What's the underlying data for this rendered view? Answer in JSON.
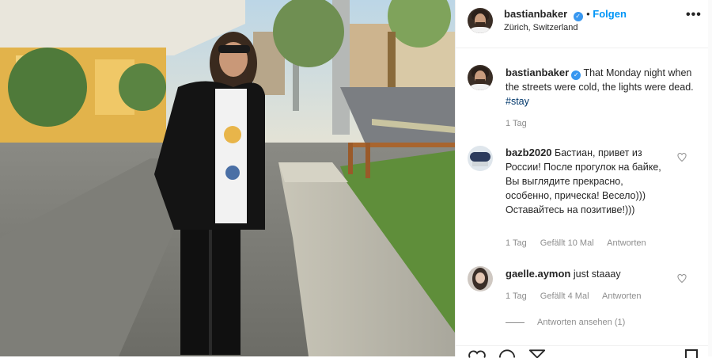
{
  "post": {
    "username": "bastianbaker",
    "follow_label": "Folgen",
    "location": "Zürich, Switzerland",
    "more_icon": "more-horizontal-icon"
  },
  "caption": {
    "username": "bastianbaker",
    "text": "That Monday night when the streets were cold, the lights were dead.",
    "hashtag": "#stay",
    "time": "1 Tag"
  },
  "comments": [
    {
      "username": "bazb2020",
      "text": "Бастиан, привет из России! После прогулок на байке, Вы выглядите прекрасно, особенно, причеcка! Весело))) Оставайтесь на позитиве!)))",
      "time": "1 Tag",
      "likes": "Gefällt 10 Mal",
      "reply": "Antworten"
    },
    {
      "username": "gaelle.aymon",
      "text": "just staaay",
      "time": "1 Tag",
      "likes": "Gefällt 4 Mal",
      "reply": "Antworten",
      "view_replies": "Antworten ansehen (1)"
    }
  ],
  "icons": [
    "verified-badge-icon",
    "heart-icon",
    "like-icon",
    "comment-icon",
    "share-icon",
    "save-icon"
  ],
  "colors": {
    "link_blue": "#0095f6",
    "verified_blue": "#3897f0",
    "meta_gray": "#8e8e8e"
  }
}
